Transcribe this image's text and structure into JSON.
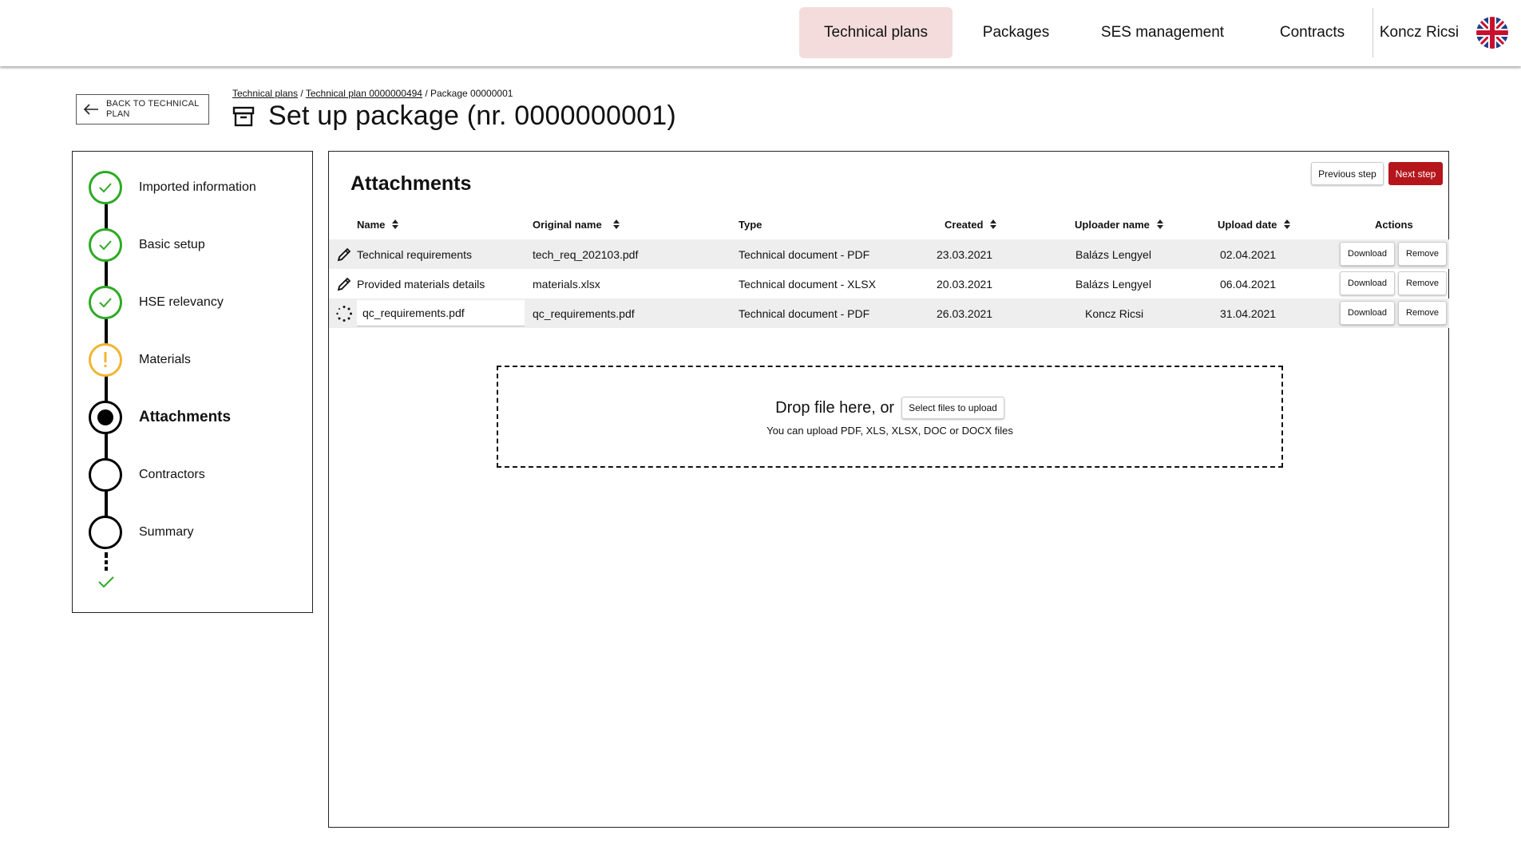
{
  "nav": {
    "items": [
      {
        "label": "Technical plans",
        "active": true
      },
      {
        "label": "Packages",
        "active": false
      },
      {
        "label": "SES management",
        "active": false
      },
      {
        "label": "Contracts",
        "active": false
      }
    ],
    "user": "Koncz Ricsi",
    "language_icon": "uk-flag-icon"
  },
  "back_button": {
    "label": "BACK TO TECHNICAL PLAN",
    "icon": "arrow-left-icon"
  },
  "breadcrumb": {
    "items": [
      "Technical plans",
      "Technical plan 0000000494",
      "Package 00000001"
    ],
    "separator": " / "
  },
  "page_title": "Set up package (nr. 0000000001)",
  "page_icon": "archive-box-icon",
  "stepper": {
    "steps": [
      {
        "label": "Imported information",
        "status": "done"
      },
      {
        "label": "Basic setup",
        "status": "done"
      },
      {
        "label": "HSE relevancy",
        "status": "done"
      },
      {
        "label": "Materials",
        "status": "warning"
      },
      {
        "label": "Attachments",
        "status": "current"
      },
      {
        "label": "Contractors",
        "status": "todo"
      },
      {
        "label": "Summary",
        "status": "todo"
      }
    ],
    "final_icon": "check-icon",
    "colors": {
      "done": "#2eaa24",
      "warning": "#f1b531",
      "current": "#000000"
    }
  },
  "main": {
    "section_title": "Attachments",
    "previous_label": "Previous step",
    "next_label": "Next step",
    "accent": "#b4161c",
    "columns": [
      "Name",
      "Original name",
      "Type",
      "Created",
      "Uploader name",
      "Upload date",
      "Actions"
    ],
    "rows": [
      {
        "icon": "pencil-icon",
        "name": "Technical requirements",
        "original": "tech_req_202103.pdf",
        "type": "Technical document - PDF",
        "created": "23.03.2021",
        "uploader": "Balázs Lengyel",
        "upload_date": "02.04.2021",
        "editing": false
      },
      {
        "icon": "pencil-icon",
        "name": "Provided materials details",
        "original": "materials.xlsx",
        "type": "Technical document - XLSX",
        "created": "20.03.2021",
        "uploader": "Balázs Lengyel",
        "upload_date": "06.04.2021",
        "editing": false
      },
      {
        "icon": "spinner-icon",
        "name": "qc_requirements.pdf",
        "original": "qc_requirements.pdf",
        "type": "Technical document - PDF",
        "created": "26.03.2021",
        "uploader": "Koncz Ricsi",
        "upload_date": "31.04.2021",
        "editing": true
      }
    ],
    "download_label": "Download",
    "remove_label": "Remove",
    "dropzone": {
      "text": "Drop file here, or",
      "button": "Select files to upload",
      "hint": "You can upload PDF, XLS, XLSX, DOC or DOCX files"
    }
  }
}
